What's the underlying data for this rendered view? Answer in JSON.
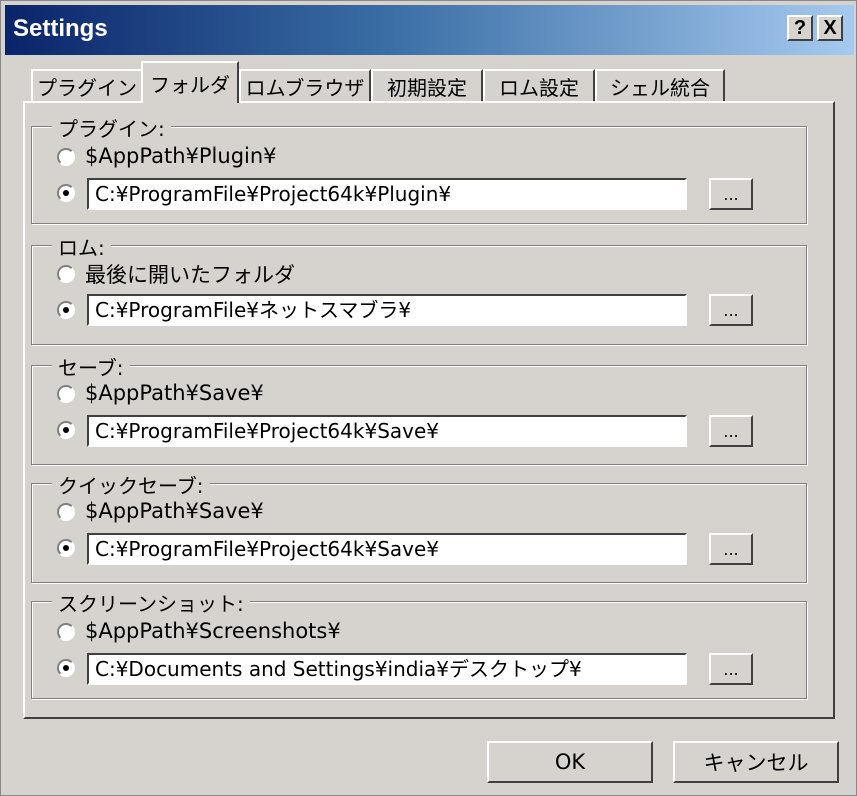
{
  "window": {
    "title": "Settings",
    "help_label": "?",
    "close_label": "X"
  },
  "tabs": [
    {
      "label": "プラグイン"
    },
    {
      "label": "フォルダ"
    },
    {
      "label": "ロムブラウザ"
    },
    {
      "label": "初期設定"
    },
    {
      "label": "ロム設定"
    },
    {
      "label": "シェル統合"
    }
  ],
  "active_tab": "フォルダ",
  "groups": {
    "plugin": {
      "legend": "プラグイン:",
      "option1": "$AppPath¥Plugin¥",
      "path": "C:¥ProgramFile¥Project64k¥Plugin¥",
      "selected": "custom"
    },
    "rom": {
      "legend": "ロム:",
      "option1": "最後に開いたフォルダ",
      "path": "C:¥ProgramFile¥ネットスマブラ¥",
      "selected": "custom"
    },
    "save": {
      "legend": "セーブ:",
      "option1": "$AppPath¥Save¥",
      "path": "C:¥ProgramFile¥Project64k¥Save¥",
      "selected": "custom"
    },
    "quicksave": {
      "legend": "クイックセーブ:",
      "option1": "$AppPath¥Save¥",
      "path": "C:¥ProgramFile¥Project64k¥Save¥",
      "selected": "custom"
    },
    "screenshot": {
      "legend": "スクリーンショット:",
      "option1": "$AppPath¥Screenshots¥",
      "path": "C:¥Documents and Settings¥india¥デスクトップ¥",
      "selected": "custom"
    }
  },
  "browse_label": "...",
  "buttons": {
    "ok": "OK",
    "cancel": "キャンセル"
  }
}
